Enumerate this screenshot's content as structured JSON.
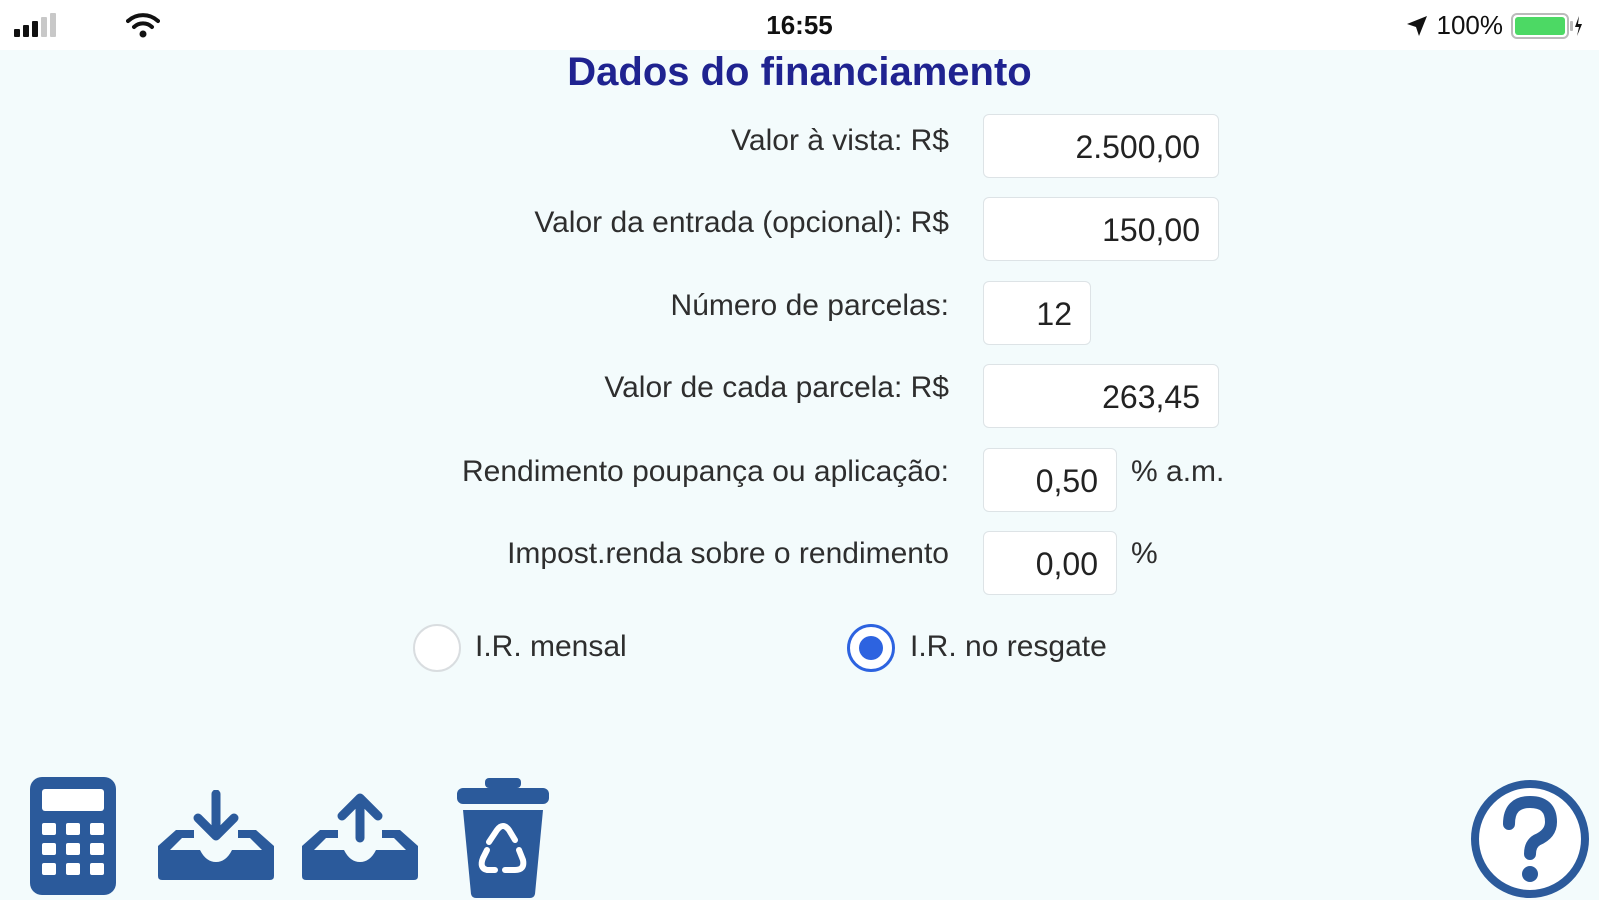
{
  "status_bar": {
    "time": "16:55",
    "battery": "100%",
    "signal_icon": "cellular-signal-icon",
    "wifi_icon": "wifi-icon",
    "location_icon": "location-arrow-icon",
    "battery_icon": "battery-icon",
    "battery_color": "#4cd964"
  },
  "header": {
    "title": "Dados do financiamento"
  },
  "form": {
    "valor_vista_label": "Valor à vista: R$",
    "valor_vista_value": "2.500,00",
    "entrada_label": "Valor da entrada (opcional): R$",
    "entrada_value": "150,00",
    "parcelas_label": "Número de parcelas:",
    "parcelas_value": "12",
    "valor_parcela_label": "Valor de cada parcela: R$",
    "valor_parcela_value": "263,45",
    "rendimento_label": "Rendimento poupança ou aplicação:",
    "rendimento_value": "0,50",
    "rendimento_suffix": "% a.m.",
    "imposto_label": "Impost.renda sobre o rendimento",
    "imposto_value": "0,00",
    "imposto_suffix": "%"
  },
  "ir_options": {
    "mensal_label": "I.R. mensal",
    "mensal_selected": false,
    "resgate_label": "I.R. no resgate",
    "resgate_selected": true
  },
  "toolbar": {
    "icons": [
      "calculator-icon",
      "download-tray-icon",
      "upload-tray-icon",
      "recycle-trash-icon",
      "help-question-icon"
    ],
    "icon_color": "#2b5a9b"
  }
}
